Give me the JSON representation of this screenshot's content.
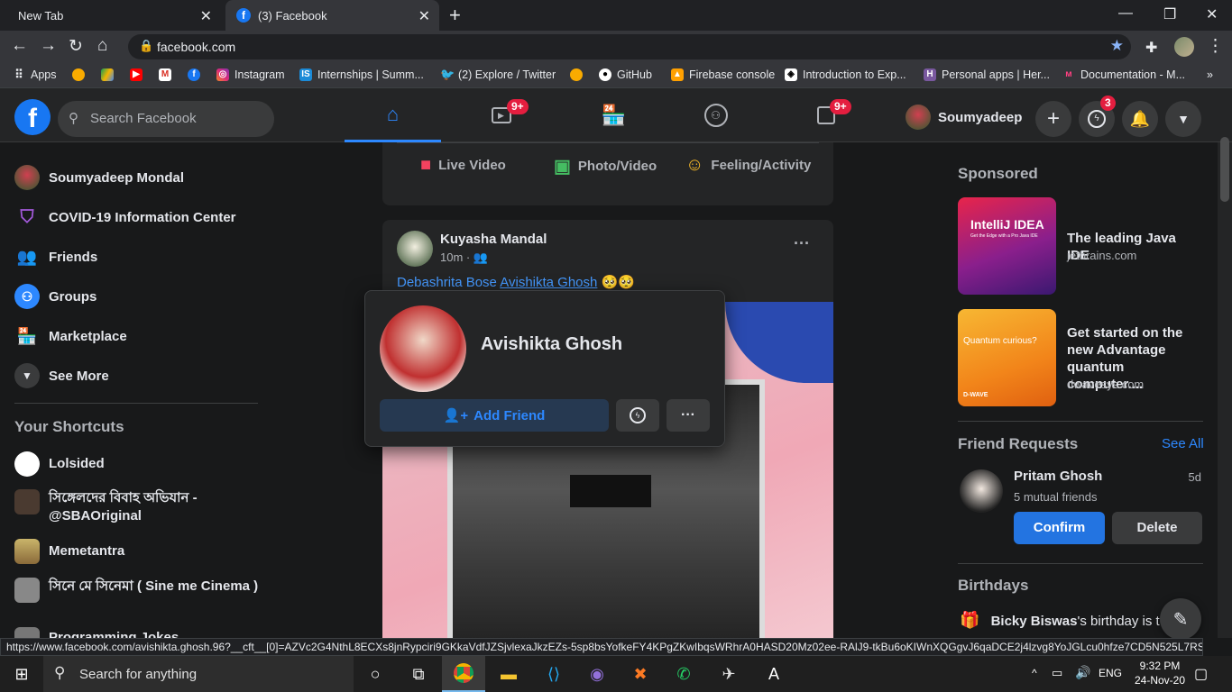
{
  "browser": {
    "tabs": [
      {
        "title": "New Tab"
      },
      {
        "title": "(3) Facebook"
      }
    ],
    "url": "facebook.com",
    "bookmarks": [
      {
        "label": "Apps"
      },
      {
        "label": "Instagram"
      },
      {
        "label": "Internships | Summ..."
      },
      {
        "label": "(2) Explore / Twitter"
      },
      {
        "label": "GitHub"
      },
      {
        "label": "Firebase console"
      },
      {
        "label": "Introduction to Exp..."
      },
      {
        "label": "Personal apps | Her..."
      },
      {
        "label": "Documentation - M..."
      }
    ],
    "bookmarks_more": "»",
    "status_url": "https://www.facebook.com/avishikta.ghosh.96?__cft__[0]=AZVc2G4NthL8ECXs8jnRypciri9GKkaVdfJZSjvlexaJkzEZs-5sp8bsYofkeFY4KPgZKwIbqsWRhrA0HASD20Mz02ee-RAlJ9-tkBu6oKIWnXQGgvJ6qaDCE2j4lzvg8YoJGLcu0hfze7CD5N525L7RSrtPBMcw..."
  },
  "fb": {
    "logo": "f",
    "search_placeholder": "Search Facebook",
    "nav_badges": {
      "watch": "9+",
      "gaming": "9+"
    },
    "profile_name": "Soumyadeep",
    "messenger_badge": "3",
    "left": {
      "items": [
        {
          "label": "Soumyadeep Mondal"
        },
        {
          "label": "COVID-19 Information Center"
        },
        {
          "label": "Friends"
        },
        {
          "label": "Groups"
        },
        {
          "label": "Marketplace"
        },
        {
          "label": "See More"
        }
      ],
      "shortcuts_title": "Your Shortcuts",
      "shortcuts": [
        {
          "label": "Lolsided"
        },
        {
          "label": "সিঙ্গেলদের বিবাহ অভিযান - @SBAOriginal"
        },
        {
          "label": "Memetantra"
        },
        {
          "label": "সিনে মে সিনেমা ( Sine me Cinema )"
        },
        {
          "label": "Programming Jokes"
        }
      ]
    },
    "composer": {
      "live": "Live Video",
      "photo": "Photo/Video",
      "feeling": "Feeling/Activity"
    },
    "post": {
      "author": "Kuyasha Mandal",
      "time": "10m ·",
      "text_tag1": "Debashrita Bose",
      "text_tag2": "Avishikta Ghosh",
      "emoji": "🥺🥺",
      "more": "···"
    },
    "hovercard": {
      "name": "Avishikta Ghosh",
      "add_friend": "Add Friend",
      "more": "···"
    },
    "right": {
      "sponsored_title": "Sponsored",
      "ads": [
        {
          "title": "The leading Java IDE",
          "domain": "jetbrains.com",
          "thumb_text": "IntelliJ IDEA",
          "thumb_sub": "Get the Edge with a Pro Java IDE"
        },
        {
          "title": "Get started on the new Advantage quantum computer....",
          "domain": "dwavesys.com",
          "thumb_text": "Quantum curious?",
          "thumb_brand": "D-WAVE"
        }
      ],
      "friend_requests_title": "Friend Requests",
      "see_all": "See All",
      "request": {
        "name": "Pritam Ghosh",
        "mutual": "5 mutual friends",
        "age": "5d",
        "confirm": "Confirm",
        "delete": "Delete"
      },
      "birthdays_title": "Birthdays",
      "birthday_name": "Bicky Biswas",
      "birthday_text": "'s birthday is to"
    }
  },
  "taskbar": {
    "search_placeholder": "Search for anything",
    "lang": "ENG",
    "time": "9:32 PM",
    "date": "24-Nov-20"
  }
}
